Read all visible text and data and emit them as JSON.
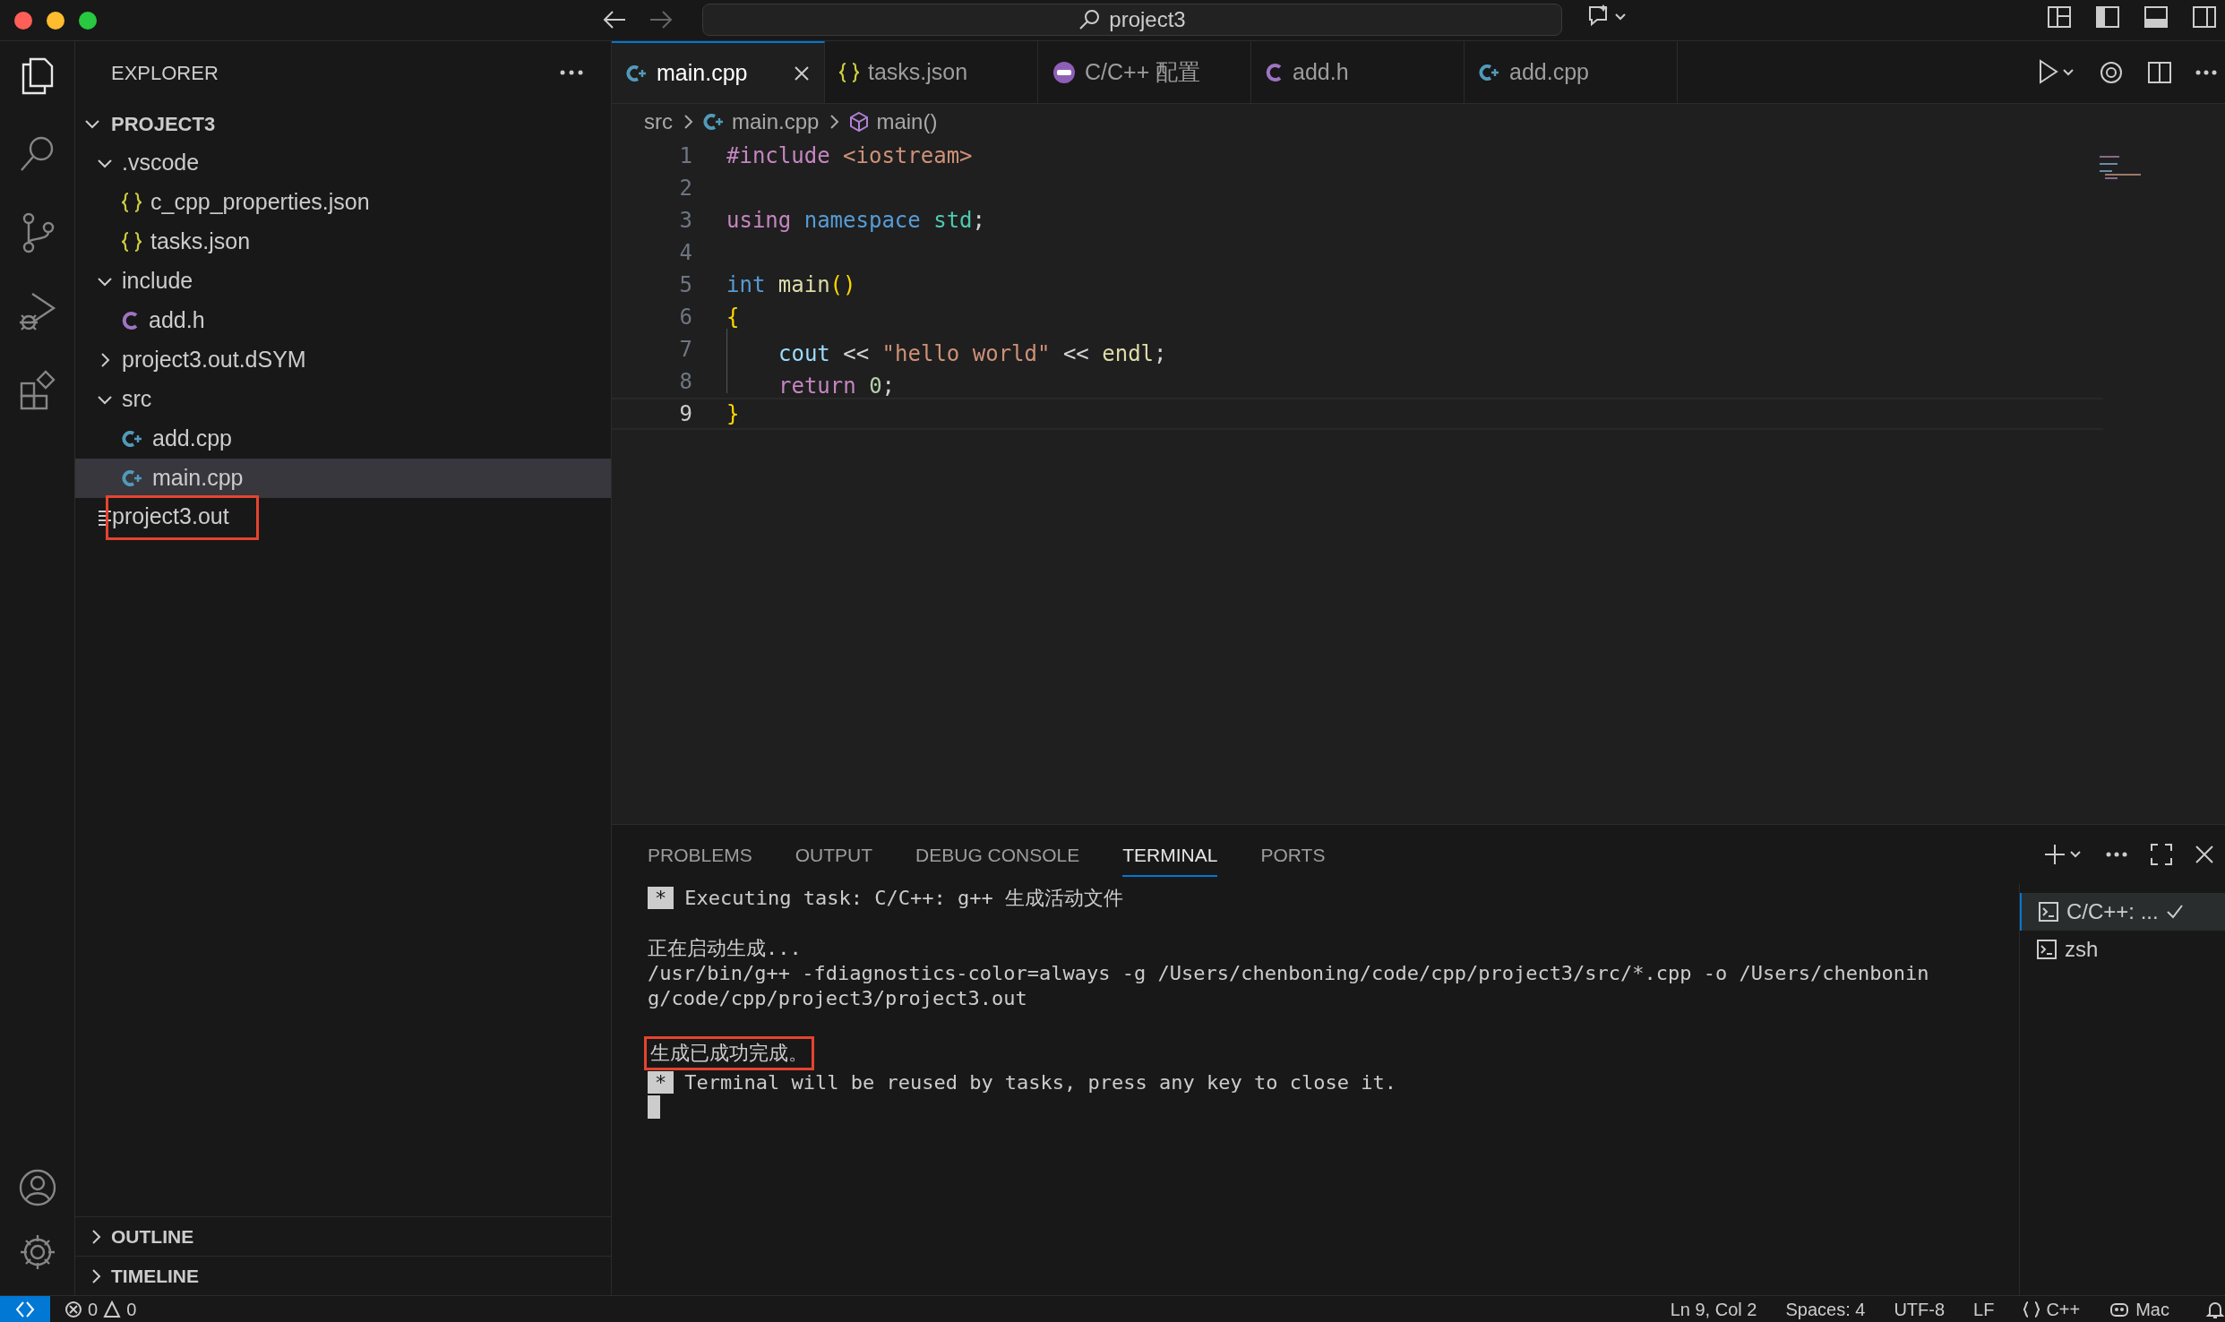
{
  "window": {
    "title": "project3"
  },
  "activity_bar": [
    {
      "kind": "files",
      "selected": true
    },
    {
      "kind": "search",
      "selected": false
    },
    {
      "kind": "source-control",
      "selected": false
    },
    {
      "kind": "run-debug",
      "selected": false
    },
    {
      "kind": "extensions",
      "selected": false
    }
  ],
  "activity_bar_bottom": [
    {
      "kind": "account"
    },
    {
      "kind": "settings"
    }
  ],
  "sidebar": {
    "title": "EXPLORER",
    "root": {
      "label": "PROJECT3",
      "expanded": true,
      "children": [
        {
          "label": ".vscode",
          "kind": "folder",
          "expanded": true,
          "selected": false,
          "highlighted": false,
          "children": [
            {
              "label": "c_cpp_properties.json",
              "kind": "json",
              "selected": false,
              "highlighted": false
            },
            {
              "label": "tasks.json",
              "kind": "json",
              "selected": false,
              "highlighted": false
            }
          ]
        },
        {
          "label": "include",
          "kind": "folder",
          "expanded": true,
          "selected": false,
          "highlighted": false,
          "children": [
            {
              "label": "add.h",
              "kind": "c",
              "selected": false,
              "highlighted": false
            }
          ]
        },
        {
          "label": "project3.out.dSYM",
          "kind": "folder",
          "expanded": false,
          "selected": false,
          "highlighted": false
        },
        {
          "label": "src",
          "kind": "folder",
          "expanded": true,
          "selected": false,
          "highlighted": false,
          "children": [
            {
              "label": "add.cpp",
              "kind": "cpp",
              "selected": false,
              "highlighted": false
            },
            {
              "label": "main.cpp",
              "kind": "cpp",
              "selected": true,
              "highlighted": false
            }
          ]
        },
        {
          "label": "project3.out",
          "kind": "binary",
          "selected": false,
          "highlighted": true
        }
      ]
    },
    "sections": [
      {
        "label": "OUTLINE",
        "expanded": false
      },
      {
        "label": "TIMELINE",
        "expanded": false
      }
    ]
  },
  "tabs": [
    {
      "label": "main.cpp",
      "kind": "cpp",
      "selected": true
    },
    {
      "label": "tasks.json",
      "kind": "json",
      "selected": false
    },
    {
      "label": "C/C++ 配置",
      "kind": "settings",
      "selected": false
    },
    {
      "label": "add.h",
      "kind": "c",
      "selected": false
    },
    {
      "label": "add.cpp",
      "kind": "cpp",
      "selected": false
    }
  ],
  "breadcrumb": [
    {
      "label": "src",
      "kind": "folder"
    },
    {
      "label": "main.cpp",
      "kind": "cpp"
    },
    {
      "label": "main()",
      "kind": "symbol"
    }
  ],
  "code": [
    {
      "number": "1",
      "current": false,
      "indented": false,
      "tokens": [
        {
          "text": "#include ",
          "kind": "directive"
        },
        {
          "text": "<iostream>",
          "kind": "string"
        }
      ]
    },
    {
      "number": "2",
      "current": false
    },
    {
      "number": "3",
      "current": false,
      "indented": false,
      "tokens": [
        {
          "text": "using ",
          "kind": "keyword"
        },
        {
          "text": "namespace ",
          "kind": "storage"
        },
        {
          "text": "std",
          "kind": "type"
        },
        {
          "text": ";",
          "kind": "punct"
        }
      ]
    },
    {
      "number": "4",
      "current": false
    },
    {
      "number": "5",
      "current": false,
      "indented": false,
      "tokens": [
        {
          "text": "int ",
          "kind": "storage"
        },
        {
          "text": "main",
          "kind": "function"
        },
        {
          "text": "()",
          "kind": "bracket"
        }
      ]
    },
    {
      "number": "6",
      "current": false,
      "indented": false,
      "tokens": [
        {
          "text": "{",
          "kind": "bracket"
        }
      ]
    },
    {
      "number": "7",
      "current": false,
      "indented": true,
      "tokens": [
        {
          "text": "cout ",
          "kind": "variable"
        },
        {
          "text": "<< ",
          "kind": "punct"
        },
        {
          "text": "\"hello world\" ",
          "kind": "string"
        },
        {
          "text": "<< ",
          "kind": "punct"
        },
        {
          "text": "endl",
          "kind": "function"
        },
        {
          "text": ";",
          "kind": "punct"
        }
      ]
    },
    {
      "number": "8",
      "current": false,
      "indented": true,
      "tokens": [
        {
          "text": "return ",
          "kind": "keyword"
        },
        {
          "text": "0",
          "kind": "number"
        },
        {
          "text": ";",
          "kind": "punct"
        }
      ]
    },
    {
      "number": "9",
      "current": true,
      "indented": false,
      "tokens": [
        {
          "text": "}",
          "kind": "bracket"
        }
      ]
    }
  ],
  "panel": {
    "tabs": [
      {
        "label": "PROBLEMS",
        "selected": false
      },
      {
        "label": "OUTPUT",
        "selected": false
      },
      {
        "label": "DEBUG CONSOLE",
        "selected": false
      },
      {
        "label": "TERMINAL",
        "selected": true
      },
      {
        "label": "PORTS",
        "selected": false
      }
    ],
    "terminal": [
      {
        "kind": "task",
        "marker": "*",
        "text": "Executing task: C/C++: g++ 生成活动文件",
        "space_before": false,
        "highlighted": false
      },
      {
        "kind": "text",
        "text": "正在启动生成...",
        "space_before": true,
        "highlighted": false
      },
      {
        "kind": "text",
        "text": "/usr/bin/g++ -fdiagnostics-color=always -g /Users/chenboning/code/cpp/project3/src/*.cpp -o /Users/chenbonin",
        "space_before": false,
        "highlighted": false
      },
      {
        "kind": "text",
        "text": "g/code/cpp/project3/project3.out",
        "space_before": false,
        "highlighted": false
      },
      {
        "kind": "text",
        "text": "生成已成功完成。",
        "space_before": true,
        "highlighted": true
      },
      {
        "kind": "task",
        "marker": "*",
        "text": "Terminal will be reused by tasks, press any key to close it.",
        "space_before": false,
        "highlighted": false
      },
      {
        "kind": "cursor",
        "space_before": false,
        "highlighted": false
      }
    ],
    "terminals": [
      {
        "label": "C/C++: ...",
        "selected": true,
        "completed": true
      },
      {
        "label": "zsh",
        "selected": false,
        "completed": false
      }
    ]
  },
  "status_bar": {
    "errors": "0",
    "warnings": "0",
    "items": [
      {
        "label": "Ln 9, Col 2",
        "kind": "text"
      },
      {
        "label": "Spaces: 4",
        "kind": "text"
      },
      {
        "label": "UTF-8",
        "kind": "text"
      },
      {
        "label": "LF",
        "kind": "text"
      },
      {
        "label": "C++",
        "kind": "language"
      },
      {
        "label": "Mac",
        "kind": "copilot"
      }
    ]
  }
}
